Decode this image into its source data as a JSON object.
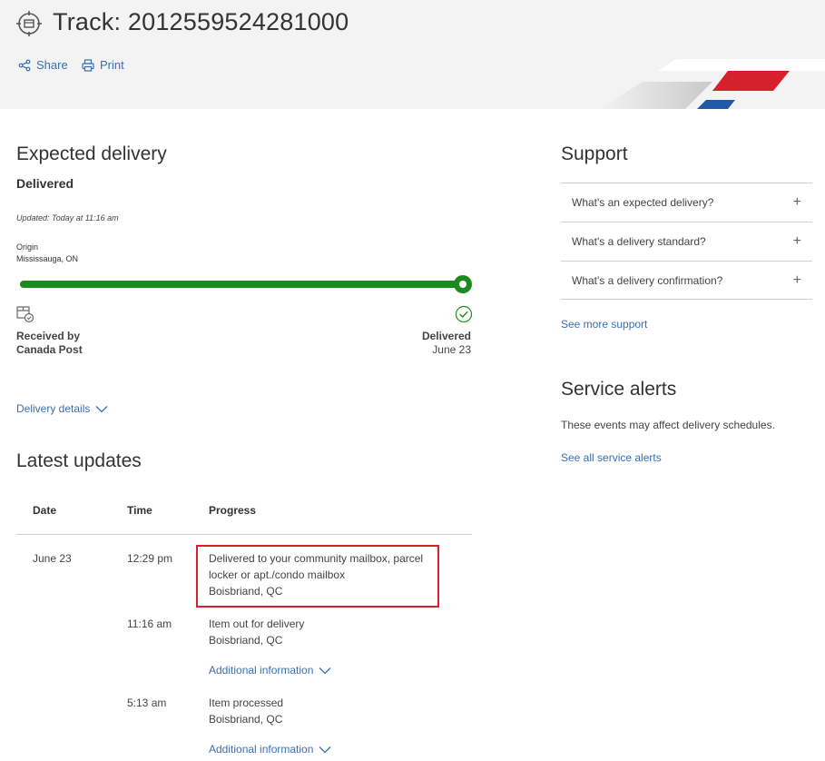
{
  "header": {
    "title": "Track: 2012559524281000",
    "share_label": "Share",
    "print_label": "Print",
    "colors": {
      "brand_red": "#d6212c",
      "brand_blue": "#1f5aa6",
      "link": "#3a6fb0"
    }
  },
  "expected": {
    "heading": "Expected delivery",
    "status": "Delivered",
    "updated": "Updated: Today at 11:16 am",
    "origin_label": "Origin",
    "origin_value": "Mississauga, ON",
    "progress_fraction": 1.0,
    "start_label_1": "Received by",
    "start_label_2": "Canada Post",
    "end_label": "Delivered",
    "end_date": "June 23",
    "details_link": "Delivery details"
  },
  "updates": {
    "heading": "Latest updates",
    "columns": [
      "Date",
      "Time",
      "Progress"
    ],
    "rows": [
      {
        "date": "June 23",
        "time": "12:29 pm",
        "line1": "Delivered to your community mailbox, parcel",
        "line2": "locker or apt./condo mailbox",
        "location": "Boisbriand, QC"
      },
      {
        "date": "",
        "time": "11:16 am",
        "line1": "Item out for delivery",
        "location": "Boisbriand, QC",
        "more": "Additional information"
      },
      {
        "date": "",
        "time": "5:13 am",
        "line1": "Item processed",
        "location": "Boisbriand, QC",
        "more": "Additional information"
      }
    ]
  },
  "support": {
    "heading": "Support",
    "items": [
      "What's an expected delivery?",
      "What's a delivery standard?",
      "What's a delivery confirmation?"
    ],
    "more_link": "See more support"
  },
  "service_alerts": {
    "heading": "Service alerts",
    "text": "These events may affect delivery schedules.",
    "link": "See all service alerts"
  }
}
